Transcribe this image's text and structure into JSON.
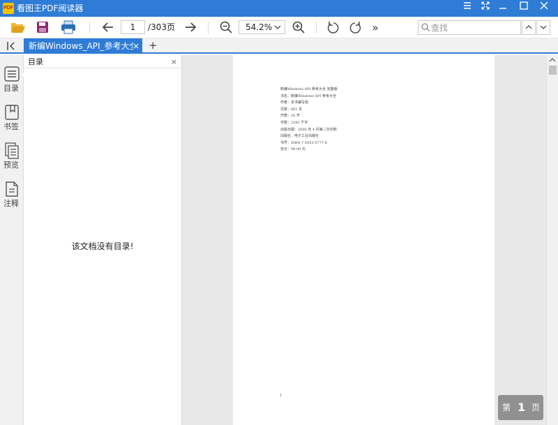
{
  "window": {
    "logo_text": "PDF",
    "title": "看图王PDF阅读器"
  },
  "toolbar": {
    "open_icon": "folder-open-icon",
    "save_icon": "save-icon",
    "print_icon": "print-icon",
    "prev_icon": "arrow-left-icon",
    "next_icon": "arrow-right-icon",
    "current_page": "1",
    "page_total": "/303页",
    "zoom_out_icon": "zoom-out-icon",
    "zoom_value": "54.2%",
    "zoom_in_icon": "zoom-in-icon",
    "rotate_left_icon": "rotate-ccw-icon",
    "rotate_right_icon": "rotate-cw-icon",
    "more_label": "»",
    "search_placeholder": "查找"
  },
  "tabs": {
    "active_tab_label": "新编Windows_API_参考大全.pdf",
    "close_label": "×",
    "add_label": "+"
  },
  "sidebar": {
    "items": [
      {
        "label": "目录",
        "icon": "list-icon"
      },
      {
        "label": "书签",
        "icon": "bookmark-icon"
      },
      {
        "label": "预览",
        "icon": "pages-icon"
      },
      {
        "label": "注释",
        "icon": "note-icon"
      }
    ]
  },
  "toc": {
    "title": "目录",
    "close_label": "×",
    "empty_message": "该文档没有目录!"
  },
  "document": {
    "metadata_lines": [
      "新编Windows API 参考大全 完整版",
      "书名：新编Windows API 参考大全",
      "作者：本书编写组",
      "页数：801 页",
      "开数：16 开",
      "字数：2392 千字",
      "出版日期：2000 年 4 月第二次印刷",
      "出版社：电子工业出版社",
      "书号：ISBN 7-5053-5777-8",
      "定价：98.00 元"
    ],
    "page_footer_number": "1"
  },
  "page_badge": {
    "prefix": "第",
    "number": "1",
    "suffix": "页"
  },
  "colors": {
    "accent": "#2e7cd6",
    "titlebar": "#2e7cd6",
    "folder_icon": "#e0a21a",
    "save_icon": "#8b2a6e",
    "print_icon": "#2c6fb5"
  }
}
